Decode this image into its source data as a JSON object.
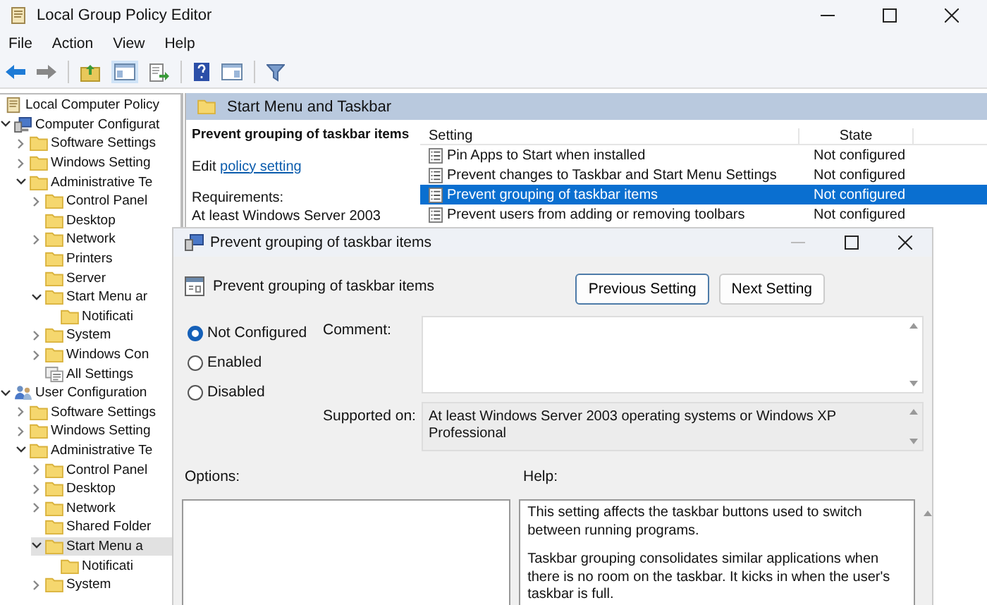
{
  "window": {
    "title": "Local Group Policy Editor"
  },
  "menu": [
    "File",
    "Action",
    "View",
    "Help"
  ],
  "tree": {
    "label": "Local Computer Policy",
    "children": [
      {
        "label": "Computer Configurat",
        "kind": "computer",
        "expandable": true,
        "expanded": true,
        "selected": false,
        "children": [
          {
            "label": "Software Settings",
            "kind": "folder",
            "expandable": true,
            "expanded": false,
            "selected": false
          },
          {
            "label": "Windows Setting",
            "kind": "folder",
            "expandable": true,
            "expanded": false,
            "selected": false
          },
          {
            "label": "Administrative Te",
            "kind": "folder",
            "expandable": true,
            "expanded": true,
            "selected": false,
            "children": [
              {
                "label": "Control Panel",
                "kind": "folder",
                "expandable": true,
                "expanded": false,
                "selected": false
              },
              {
                "label": "Desktop",
                "kind": "folder",
                "expandable": false,
                "expanded": false,
                "selected": false
              },
              {
                "label": "Network",
                "kind": "folder",
                "expandable": true,
                "expanded": false,
                "selected": false
              },
              {
                "label": "Printers",
                "kind": "folder",
                "expandable": false,
                "expanded": false,
                "selected": false
              },
              {
                "label": "Server",
                "kind": "folder",
                "expandable": false,
                "expanded": false,
                "selected": false
              },
              {
                "label": "Start Menu ar",
                "kind": "folder",
                "expandable": true,
                "expanded": true,
                "selected": false,
                "children": [
                  {
                    "label": "Notificati",
                    "kind": "folder",
                    "expandable": false,
                    "expanded": false,
                    "selected": false
                  }
                ]
              },
              {
                "label": "System",
                "kind": "folder",
                "expandable": true,
                "expanded": false,
                "selected": false
              },
              {
                "label": "Windows Con",
                "kind": "folder",
                "expandable": true,
                "expanded": false,
                "selected": false
              },
              {
                "label": "All Settings",
                "kind": "settings",
                "expandable": false,
                "expanded": false,
                "selected": false
              }
            ]
          }
        ]
      },
      {
        "label": "User Configuration",
        "kind": "user",
        "expandable": true,
        "expanded": true,
        "selected": false,
        "children": [
          {
            "label": "Software Settings",
            "kind": "folder",
            "expandable": true,
            "expanded": false,
            "selected": false
          },
          {
            "label": "Windows Setting",
            "kind": "folder",
            "expandable": true,
            "expanded": false,
            "selected": false
          },
          {
            "label": "Administrative Te",
            "kind": "folder",
            "expandable": true,
            "expanded": true,
            "selected": false,
            "children": [
              {
                "label": "Control Panel",
                "kind": "folder",
                "expandable": true,
                "expanded": false,
                "selected": false
              },
              {
                "label": "Desktop",
                "kind": "folder",
                "expandable": true,
                "expanded": false,
                "selected": false
              },
              {
                "label": "Network",
                "kind": "folder",
                "expandable": true,
                "expanded": false,
                "selected": false
              },
              {
                "label": "Shared Folder",
                "kind": "folder",
                "expandable": false,
                "expanded": false,
                "selected": false
              },
              {
                "label": "Start Menu a",
                "kind": "folder",
                "expandable": true,
                "expanded": true,
                "selected": true,
                "children": [
                  {
                    "label": "Notificati",
                    "kind": "folder",
                    "expandable": false,
                    "expanded": false,
                    "selected": false
                  }
                ]
              },
              {
                "label": "System",
                "kind": "folder",
                "expandable": true,
                "expanded": false,
                "selected": false
              }
            ]
          }
        ]
      }
    ]
  },
  "pane": {
    "title": "Start Menu and Taskbar",
    "description": {
      "title": "Prevent grouping of taskbar items",
      "edit_prefix": "Edit",
      "edit_link": "policy setting",
      "requirements_label": "Requirements:",
      "requirements": "At least Windows Server 2003"
    },
    "table": {
      "columns": [
        "Setting",
        "State"
      ],
      "rows": [
        {
          "setting": "Pin Apps to Start when installed",
          "state": "Not configured",
          "selected": false
        },
        {
          "setting": "Prevent changes to Taskbar and Start Menu Settings",
          "state": "Not configured",
          "selected": false
        },
        {
          "setting": "Prevent grouping of taskbar items",
          "state": "Not configured",
          "selected": true
        },
        {
          "setting": "Prevent users from adding or removing toolbars",
          "state": "Not configured",
          "selected": false
        }
      ]
    }
  },
  "dialog": {
    "title": "Prevent grouping of taskbar items",
    "setting_name": "Prevent grouping of taskbar items",
    "buttons": [
      "Previous Setting",
      "Next Setting"
    ],
    "options": [
      {
        "label": "Not Configured",
        "selected": true
      },
      {
        "label": "Enabled",
        "selected": false
      },
      {
        "label": "Disabled",
        "selected": false
      }
    ],
    "comment_label": "Comment:",
    "supported_label": "Supported on:",
    "supported": "At least Windows Server 2003 operating systems or Windows XP Professional",
    "options_label": "Options:",
    "help_label": "Help:",
    "help": [
      "This setting affects the taskbar buttons used to switch between running programs.",
      "Taskbar grouping consolidates similar applications when there is no room on the taskbar. It kicks in when the user's taskbar is full."
    ]
  }
}
